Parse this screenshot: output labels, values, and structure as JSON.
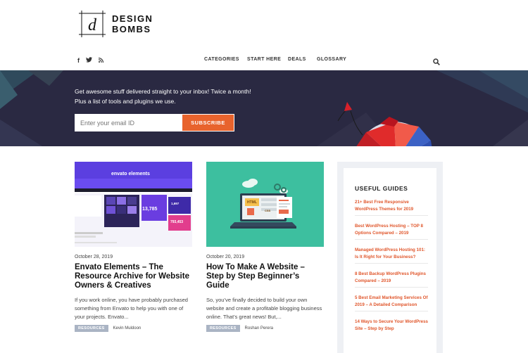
{
  "brand": {
    "line1": "DESIGN",
    "line2": "BOMBS",
    "mark": "d"
  },
  "social": [
    "f",
    "t",
    "rss"
  ],
  "nav": {
    "items": [
      "CATEGORIES",
      "START HERE",
      "DEALS",
      "GLOSSARY"
    ]
  },
  "hero": {
    "line1": "Get awesome stuff delivered straight to your inbox! Twice a month!",
    "line2": "Plus a list of tools and plugins we use.",
    "email_placeholder": "Enter your email ID",
    "subscribe_label": "SUBSCRIBE"
  },
  "posts": [
    {
      "image_brand": "envato elements",
      "image_numbers": [
        "13,785",
        "1,697",
        "793,453"
      ],
      "date": "October 28, 2019",
      "title": "Envato Elements – The Resource Archive for Website Owners & Creatives",
      "excerpt": "If you work online, you have probably purchased something from Envato to help you with one of your projects. Envato...",
      "tag": "RESOURCES",
      "author": "Kevin Muldoon"
    },
    {
      "image_labels": [
        "HTML",
        "CSS"
      ],
      "date": "October 20, 2019",
      "title": "How To Make A Website – Step by Step Beginner’s Guide",
      "excerpt": "So, you’ve finally decided to build your own website and create a profitable blogging business online. That’s great news! But,...",
      "tag": "RESOURCES",
      "author": "Roshan Perera"
    }
  ],
  "sidebar": {
    "title": "USEFUL GUIDES",
    "guides": [
      "21+ Best Free Responsive WordPress Themes for 2019",
      "Best WordPress Hosting – TOP 8 Options Compared – 2019",
      "Managed WordPress Hosting 101: Is It Right for Your Business?",
      "8 Best Backup WordPress Plugins Compared – 2019",
      "5 Best Email Marketing Services Of 2019 – A Detailed Comparison",
      "14 Ways to Secure Your WordPress Site – Step by Step"
    ]
  },
  "colors": {
    "accent": "#e8632d",
    "hero_bg": "#2a2942",
    "tag_bg": "#aab4c4",
    "envato_purple": "#5b3fe0",
    "card2_bg": "#3dbf9f"
  }
}
